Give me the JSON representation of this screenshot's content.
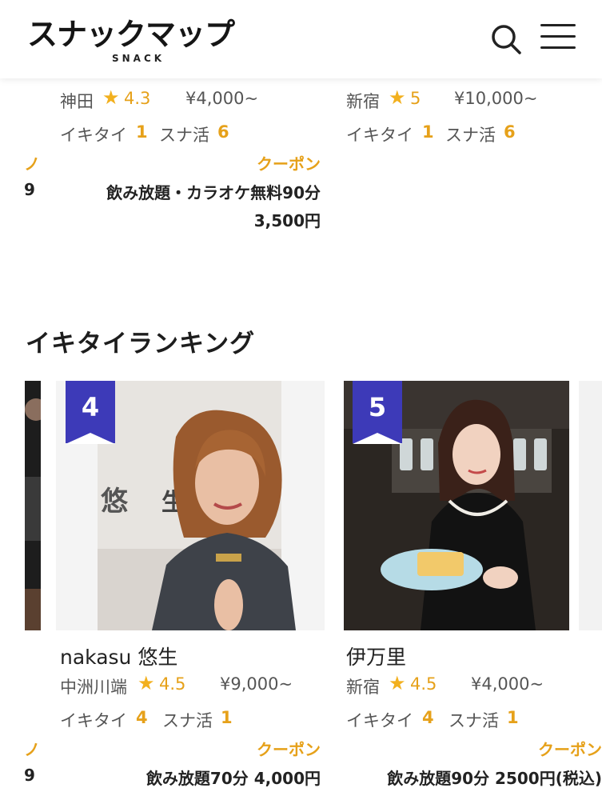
{
  "header": {
    "logo_text": "スナックマップ",
    "logo_sub": "SNACK"
  },
  "top_cards": [
    {
      "area": "神田",
      "rating": "4.3",
      "price": "¥4,000~",
      "ikitai_label": "イキタイ",
      "ikitai": "1",
      "sunakatsu_label": "スナ活",
      "sunakatsu": "6",
      "coupon_label": "クーポン",
      "coupon_line1": "飲み放題・カラオケ無料90分",
      "coupon_line2": "3,500円"
    },
    {
      "area": "新宿",
      "rating": "5",
      "price": "¥10,000~",
      "ikitai_label": "イキタイ",
      "ikitai": "1",
      "sunakatsu_label": "スナ活",
      "sunakatsu": "6"
    }
  ],
  "left_partial": {
    "edge1": "ノ",
    "edge2": "9"
  },
  "ranking": {
    "title": "イキタイランキング",
    "cards": [
      {
        "rank": "4",
        "name": "nakasu 悠生",
        "area": "中洲川端",
        "rating": "4.5",
        "price": "¥9,000~",
        "ikitai_label": "イキタイ",
        "ikitai": "4",
        "sunakatsu_label": "スナ活",
        "sunakatsu": "1",
        "coupon_label": "クーポン",
        "coupon_line1": "飲み放題70分 4,000円",
        "photo_sign": "悠 生"
      },
      {
        "rank": "5",
        "name": "伊万里",
        "area": "新宿",
        "rating": "4.5",
        "price": "¥4,000~",
        "ikitai_label": "イキタイ",
        "ikitai": "4",
        "sunakatsu_label": "スナ活",
        "sunakatsu": "1",
        "coupon_label": "クーポン",
        "coupon_line1": "飲み放題90分 2500円(税込)"
      }
    ]
  },
  "colors": {
    "accent": "#e6a11a",
    "ribbon": "#3d3ab8",
    "star": "#f2b01e"
  },
  "icons": {
    "search": "search-icon",
    "menu": "hamburger-menu-icon",
    "star": "star-icon"
  }
}
